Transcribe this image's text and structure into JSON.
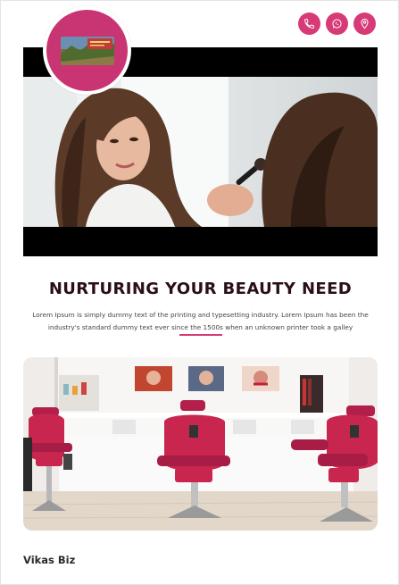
{
  "header": {
    "actions": [
      {
        "name": "phone-button",
        "icon": "phone-icon"
      },
      {
        "name": "whatsapp-button",
        "icon": "whatsapp-icon"
      },
      {
        "name": "location-button",
        "icon": "location-pin-icon"
      }
    ],
    "accent_color": "#d63a77",
    "logo_color": "#c93572"
  },
  "main": {
    "title": "NURTURING YOUR BEAUTY NEED",
    "description": "Lorem Ipsum is simply dummy text of the printing and typesetting industry. Lorem Ipsum has been the industry's standard dummy text ever since the 1500s when an unknown printer took a galley"
  },
  "footer": {
    "brand": "Vikas Biz"
  }
}
